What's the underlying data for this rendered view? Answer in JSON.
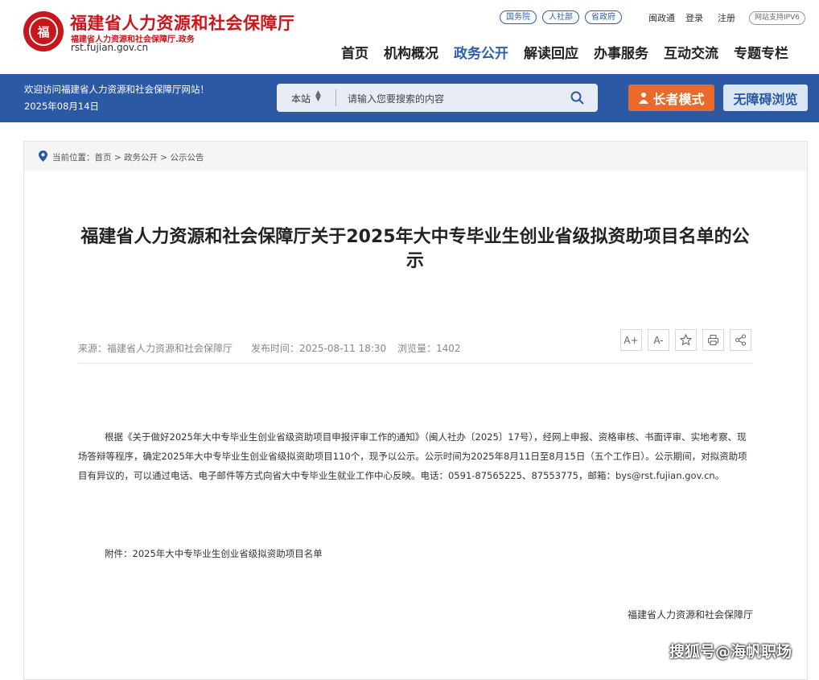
{
  "header": {
    "site_title": "福建省人力资源和社会保障厅",
    "site_subtitle": "福建省人力资源和社会保障厅.政务",
    "site_url": "rst.fujian.gov.cn",
    "seal_glyph": "福",
    "top_links": [
      "国务院",
      "人社部",
      "省政府"
    ],
    "text_links": [
      "闽政通",
      "登录",
      "注册"
    ],
    "ipv6_badge": "网站支持IPV6",
    "nav": [
      "首页",
      "机构概况",
      "政务公开",
      "解读回应",
      "办事服务",
      "互动交流",
      "专题专栏"
    ],
    "nav_active": "政务公开"
  },
  "bluebar": {
    "welcome": "欢迎访问福建省人力资源和社会保障厅网站！",
    "date": "2025年08月14日",
    "search_scope": "本站",
    "search_placeholder": "请输入您要搜索的内容",
    "elder_mode": "长者模式",
    "accessible": "无障碍浏览"
  },
  "breadcrumb": "当前位置：首页 > 政务公开 > 公示公告",
  "article": {
    "title": "福建省人力资源和社会保障厅关于2025年大中专毕业生创业省级拟资助项目名单的公示",
    "source": "来源：福建省人力资源和社会保障厅",
    "publish_time": "发布时间：2025-08-11 18:30",
    "views": "浏览量：1402",
    "tools": [
      "A+",
      "A-",
      "star-icon",
      "print-icon",
      "share-icon"
    ],
    "body": "根据《关于做好2025年大中专毕业生创业省级资助项目申报评审工作的通知》（闽人社办〔2025〕17号），经网上申报、资格审核、书面评审、实地考察、现场答辩等程序，确定2025年大中专毕业生创业省级拟资助项目110个，现予以公示。公示时间为2025年8月11日至8月15日（五个工作日）。公示期间，对拟资助项目有异议的，可以通过电话、电子邮件等方式向省大中专毕业生就业工作中心反映。电话：0591-87565225、87553775，邮箱：bys@rst.fujian.gov.cn。",
    "attachment": "附件：2025年大中专毕业生创业省级拟资助项目名单",
    "signature": "福建省人力资源和社会保障厅"
  },
  "watermark": "搜狐号@海帆职场",
  "colors": {
    "brand_red": "#c8161d",
    "brand_blue": "#2b59a4",
    "elder_orange": "#ea6a2b"
  }
}
